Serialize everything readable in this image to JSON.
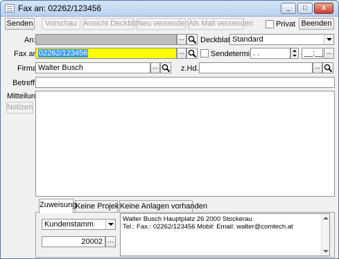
{
  "window": {
    "title": "Fax an: 02262/123456",
    "min_glyph": "_",
    "max_glyph": "□",
    "close_glyph": "x"
  },
  "toolbar": {
    "send": "Senden",
    "preview": "Vorschau",
    "cover_view": "Ansicht Deckblatt",
    "resend": "Neu versenden",
    "as_mail": "Als Mail versenden",
    "private": "Privat",
    "exit": "Beenden"
  },
  "form": {
    "to_label": "An:",
    "to_value": "",
    "fax_label": "Fax an:",
    "fax_value": "02262/123456",
    "company_label": "Firma:",
    "company_value": "Walter Busch",
    "subject_label": "Betreff:",
    "subject_value": "",
    "message_label": "Mitteilung:",
    "notes_button": "Notizen",
    "cover_label": "Deckblatt:",
    "cover_value": "Standard",
    "send_date_label": "Sendetermin",
    "date_value": ". .",
    "time_value": "__:__",
    "attn_label": "z.Hd.:",
    "attn_value": "",
    "dots": "..."
  },
  "tabs": [
    {
      "label": "Zuweisung",
      "active": true
    },
    {
      "label": "Keine Projekte",
      "active": false
    },
    {
      "label": "Keine Anlagen vorhanden",
      "active": false
    }
  ],
  "assignment": {
    "category_value": "Kundenstamm",
    "number_value": "20002",
    "info_line1": "Walter Busch   Hauptplatz 26 2000  Stockerau",
    "info_line2": "Tel.:  Fax.: 02262/123456 Mobil:  Email: walter@comtech.at"
  },
  "colors": {
    "fax_field": "#ffff00",
    "to_field": "#bdbdbd",
    "selection": "#3399ff"
  },
  "icons": [
    "app-icon",
    "minimize-icon",
    "maximize-icon",
    "close-icon",
    "search-icon",
    "dropdown-arrow-icon",
    "spinner-icon"
  ]
}
